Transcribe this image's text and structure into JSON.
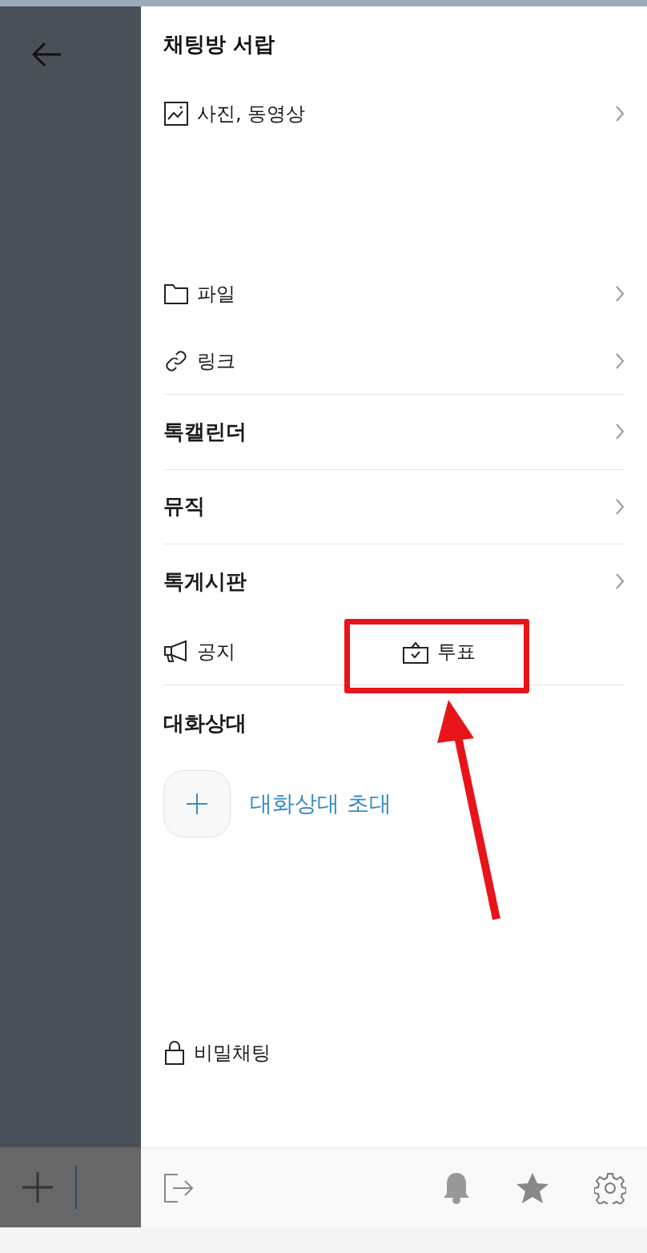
{
  "title": "채팅방 서랍",
  "storage_items": [
    "사진, 동영상",
    "파일",
    "링크"
  ],
  "features": [
    "톡캘린더",
    "뮤직",
    "톡게시판"
  ],
  "board_actions": [
    "공지",
    "투표"
  ],
  "members": {
    "title": "대화상대",
    "invite": "대화상대 초대"
  },
  "secret_chat": "비밀채팅"
}
